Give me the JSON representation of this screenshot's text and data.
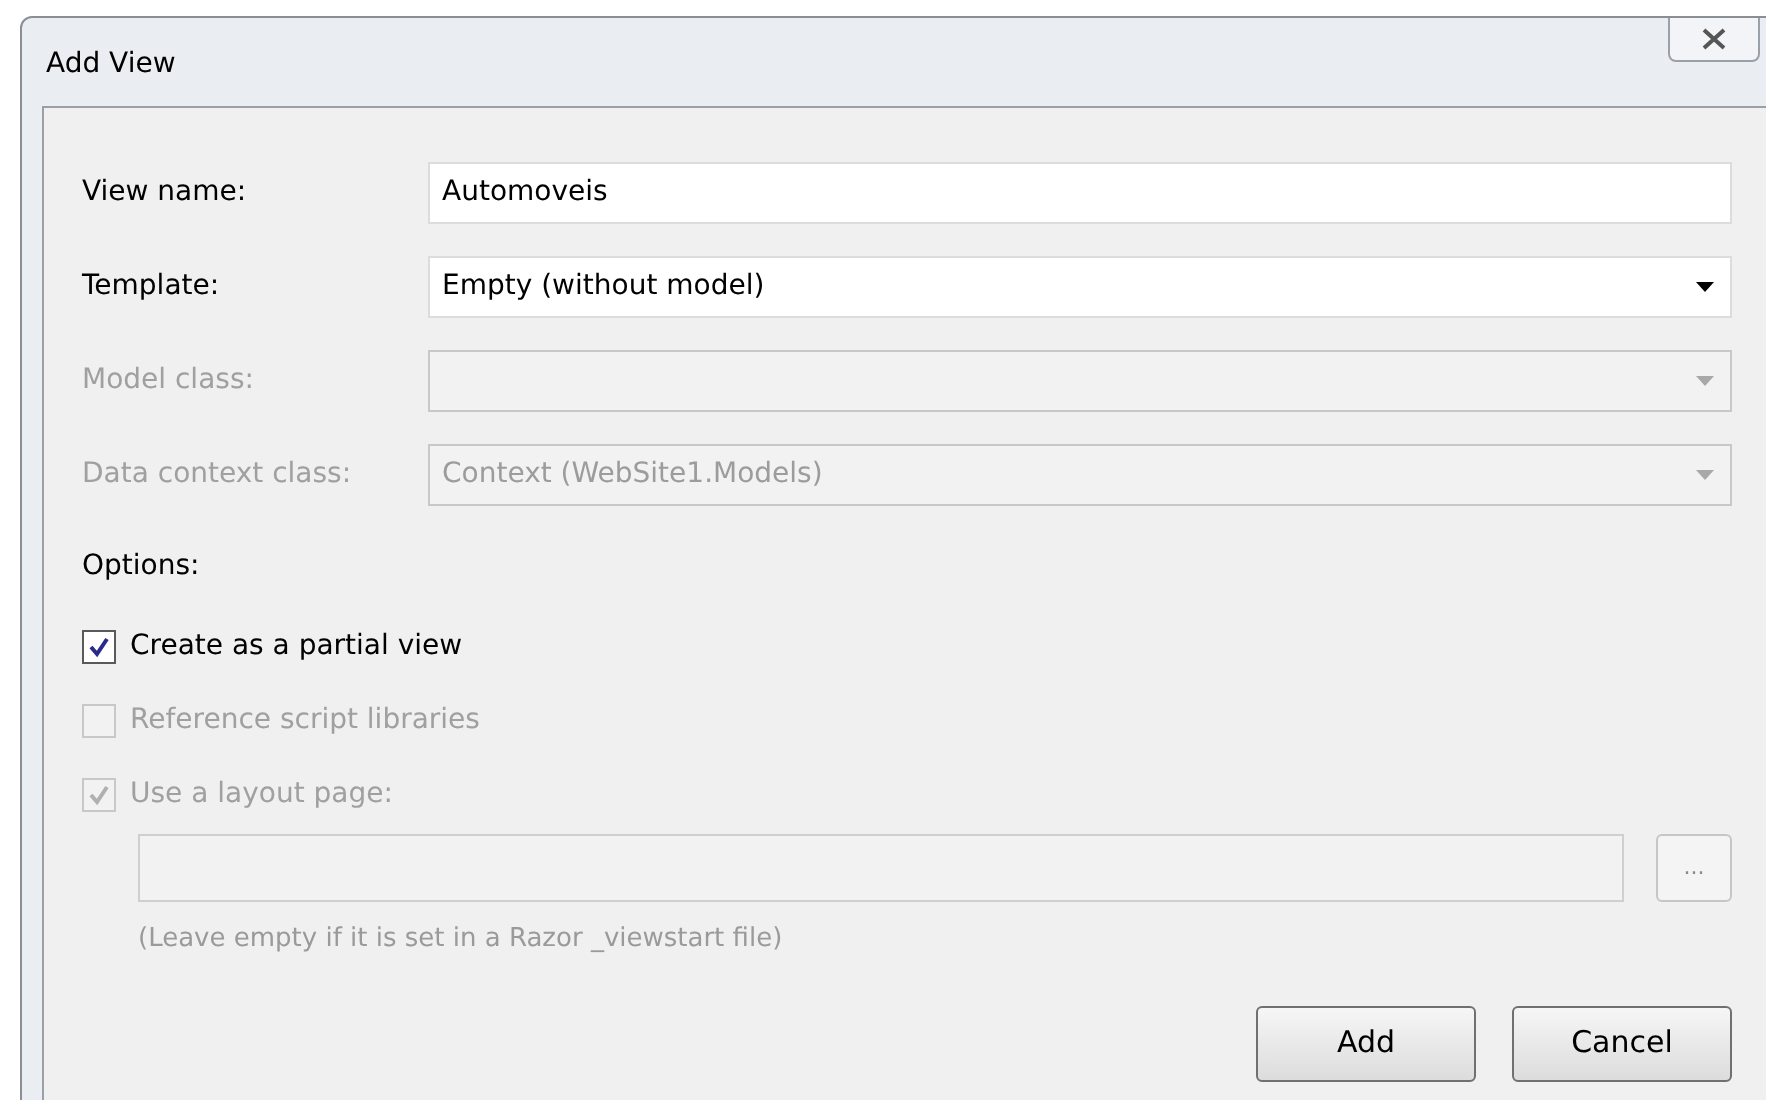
{
  "window": {
    "title": "Add View"
  },
  "fields": [
    {
      "kind": "text",
      "label": "View name:",
      "value": "Automoveis",
      "disabled": false
    },
    {
      "kind": "dropdown",
      "label": "Template:",
      "value": "Empty (without model)",
      "disabled": false
    },
    {
      "kind": "dropdown",
      "label": "Model class:",
      "disabled": true
    },
    {
      "kind": "dropdown",
      "label": "Data context class:",
      "value": "Context (WebSite1.Models)",
      "disabled": true
    }
  ],
  "options_label": "Options:",
  "checkboxes": [
    {
      "label": "Create as a partial view",
      "checked": true,
      "disabled": false
    },
    {
      "label": "Reference script libraries",
      "checked": false,
      "disabled": true
    },
    {
      "label": "Use a layout page:",
      "checked": true,
      "disabled": true
    }
  ],
  "layout_path": {
    "disabled": true,
    "browse_label": "...",
    "hint": "(Leave empty if it is set in a Razor _viewstart file)"
  },
  "buttons": [
    "Add",
    "Cancel"
  ]
}
